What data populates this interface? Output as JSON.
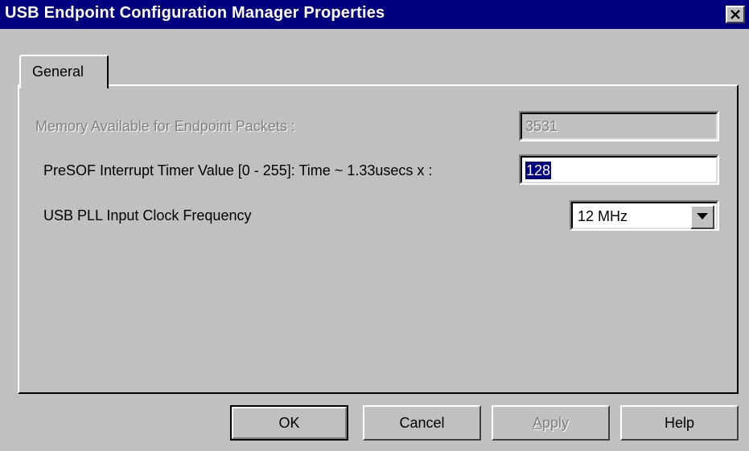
{
  "window": {
    "title": "USB Endpoint Configuration Manager Properties",
    "close_icon": "close-icon"
  },
  "tabs": [
    {
      "label": "General",
      "selected": true
    }
  ],
  "general": {
    "memory": {
      "label": "Memory Available for Endpoint Packets :",
      "value": "3531",
      "enabled": false
    },
    "presof": {
      "label": "PreSOF Interrupt Timer Value [0 - 255]: Time ~ 1.33usecs x :",
      "value": "128",
      "selected": true
    },
    "pll": {
      "label": "USB PLL Input Clock Frequency",
      "selected_option": "12 MHz",
      "arrow_icon": "chevron-down-icon"
    }
  },
  "buttons": {
    "ok": "OK",
    "cancel": "Cancel",
    "apply_first": "A",
    "apply_rest": "pply",
    "help": "Help"
  },
  "colors": {
    "titlebar": "#000080",
    "face": "#c0c0c0",
    "selection": "#000080"
  }
}
